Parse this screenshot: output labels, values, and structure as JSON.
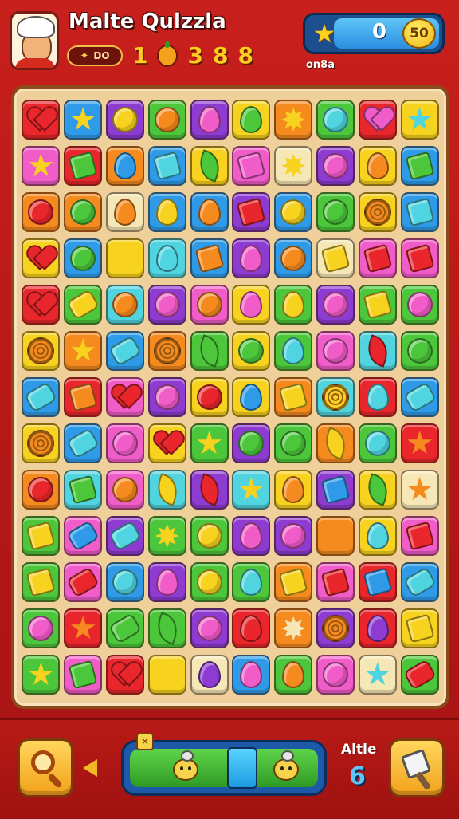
{
  "header": {
    "title": "Malte Qulzzla",
    "level_label": "DO",
    "fruit_count": "1",
    "fruit_stats": [
      "3",
      "8",
      "8"
    ],
    "score": "0",
    "coins": "50",
    "score_caption": "on8a"
  },
  "footer": {
    "moves_label": "Altle",
    "moves_value": "6"
  },
  "colors": {
    "red": "#e8262b",
    "orange": "#f58a1f",
    "yellow": "#f7d21f",
    "green": "#4cc63a",
    "blue": "#2f9be8",
    "purple": "#8d3bd0",
    "pink": "#f05cc8",
    "cream": "#f6e8b6",
    "teal": "#4fd4e0"
  },
  "board": {
    "rows": 13,
    "cols": 10,
    "tiles": [
      [
        [
          "red",
          "heart",
          "red"
        ],
        [
          "blue",
          "star",
          "yellow"
        ],
        [
          "purple",
          "circle",
          "yellow"
        ],
        [
          "green",
          "circle",
          "orange"
        ],
        [
          "purple",
          "drop",
          "pink"
        ],
        [
          "yellow",
          "drop",
          "green"
        ],
        [
          "orange",
          "sun",
          "yellow"
        ],
        [
          "green",
          "circle",
          "teal"
        ],
        [
          "red",
          "heart",
          "pink"
        ],
        [
          "yellow",
          "star",
          "teal"
        ]
      ],
      [
        [
          "pink",
          "star",
          "yellow"
        ],
        [
          "red",
          "square",
          "green"
        ],
        [
          "orange",
          "drop",
          "blue"
        ],
        [
          "blue",
          "square",
          "teal"
        ],
        [
          "yellow",
          "leaf",
          "green"
        ],
        [
          "pink",
          "square",
          "pink"
        ],
        [
          "cream",
          "sun",
          "yellow"
        ],
        [
          "purple",
          "circle",
          "pink"
        ],
        [
          "yellow",
          "drop",
          "orange"
        ],
        [
          "blue",
          "square",
          "green"
        ]
      ],
      [
        [
          "orange",
          "circle",
          "red"
        ],
        [
          "orange",
          "circle",
          "green"
        ],
        [
          "cream",
          "drop",
          "orange"
        ],
        [
          "blue",
          "drop",
          "yellow"
        ],
        [
          "blue",
          "drop",
          "orange"
        ],
        [
          "purple",
          "square",
          "red"
        ],
        [
          "blue",
          "circle",
          "yellow"
        ],
        [
          "green",
          "circle",
          "green"
        ],
        [
          "yellow",
          "swirl",
          "orange"
        ],
        [
          "blue",
          "square",
          "teal"
        ]
      ],
      [
        [
          "yellow",
          "heart",
          "red"
        ],
        [
          "blue",
          "circle",
          "green"
        ],
        [
          "yellow",
          "star",
          "yellow"
        ],
        [
          "teal",
          "drop",
          "teal"
        ],
        [
          "blue",
          "square",
          "orange"
        ],
        [
          "purple",
          "drop",
          "pink"
        ],
        [
          "blue",
          "circle",
          "orange"
        ],
        [
          "cream",
          "square",
          "yellow"
        ],
        [
          "pink",
          "square",
          "red"
        ],
        [
          "pink",
          "square",
          "red"
        ]
      ],
      [
        [
          "red",
          "heart",
          "red"
        ],
        [
          "green",
          "bone",
          "yellow"
        ],
        [
          "teal",
          "circle",
          "orange"
        ],
        [
          "purple",
          "circle",
          "pink"
        ],
        [
          "pink",
          "circle",
          "orange"
        ],
        [
          "yellow",
          "drop",
          "pink"
        ],
        [
          "green",
          "drop",
          "yellow"
        ],
        [
          "purple",
          "circle",
          "pink"
        ],
        [
          "green",
          "square",
          "yellow"
        ],
        [
          "green",
          "circle",
          "pink"
        ]
      ],
      [
        [
          "yellow",
          "swirl",
          "orange"
        ],
        [
          "orange",
          "star",
          "yellow"
        ],
        [
          "blue",
          "bone",
          "teal"
        ],
        [
          "orange",
          "swirl",
          "orange"
        ],
        [
          "green",
          "leaf",
          "green"
        ],
        [
          "yellow",
          "circle",
          "green"
        ],
        [
          "green",
          "drop",
          "teal"
        ],
        [
          "pink",
          "circle",
          "pink"
        ],
        [
          "teal",
          "leaf",
          "red"
        ],
        [
          "green",
          "circle",
          "green"
        ]
      ],
      [
        [
          "blue",
          "bone",
          "teal"
        ],
        [
          "red",
          "square",
          "orange"
        ],
        [
          "pink",
          "heart",
          "red"
        ],
        [
          "purple",
          "circle",
          "pink"
        ],
        [
          "yellow",
          "circle",
          "red"
        ],
        [
          "yellow",
          "drop",
          "blue"
        ],
        [
          "orange",
          "square",
          "yellow"
        ],
        [
          "teal",
          "swirl",
          "yellow"
        ],
        [
          "red",
          "drop",
          "teal"
        ],
        [
          "blue",
          "bone",
          "teal"
        ]
      ],
      [
        [
          "yellow",
          "swirl",
          "orange"
        ],
        [
          "blue",
          "bone",
          "teal"
        ],
        [
          "pink",
          "circle",
          "pink"
        ],
        [
          "yellow",
          "heart",
          "red"
        ],
        [
          "green",
          "star",
          "yellow"
        ],
        [
          "purple",
          "circle",
          "green"
        ],
        [
          "green",
          "circle",
          "green"
        ],
        [
          "orange",
          "leaf",
          "yellow"
        ],
        [
          "green",
          "circle",
          "teal"
        ],
        [
          "red",
          "star",
          "orange"
        ]
      ],
      [
        [
          "orange",
          "circle",
          "red"
        ],
        [
          "teal",
          "square",
          "green"
        ],
        [
          "pink",
          "circle",
          "orange"
        ],
        [
          "teal",
          "leaf",
          "yellow"
        ],
        [
          "purple",
          "leaf",
          "red"
        ],
        [
          "teal",
          "star",
          "yellow"
        ],
        [
          "yellow",
          "drop",
          "orange"
        ],
        [
          "purple",
          "square",
          "blue"
        ],
        [
          "yellow",
          "leaf",
          "green"
        ],
        [
          "cream",
          "star",
          "orange"
        ]
      ],
      [
        [
          "green",
          "square",
          "yellow"
        ],
        [
          "pink",
          "bone",
          "blue"
        ],
        [
          "purple",
          "bone",
          "teal"
        ],
        [
          "green",
          "sun",
          "yellow"
        ],
        [
          "green",
          "circle",
          "yellow"
        ],
        [
          "purple",
          "drop",
          "pink"
        ],
        [
          "purple",
          "circle",
          "pink"
        ],
        [
          "orange",
          "star",
          "orange"
        ],
        [
          "yellow",
          "drop",
          "teal"
        ],
        [
          "pink",
          "square",
          "red"
        ]
      ],
      [
        [
          "green",
          "square",
          "yellow"
        ],
        [
          "pink",
          "bone",
          "red"
        ],
        [
          "blue",
          "circle",
          "teal"
        ],
        [
          "purple",
          "drop",
          "pink"
        ],
        [
          "green",
          "circle",
          "yellow"
        ],
        [
          "green",
          "drop",
          "teal"
        ],
        [
          "orange",
          "square",
          "yellow"
        ],
        [
          "pink",
          "square",
          "red"
        ],
        [
          "red",
          "square",
          "blue"
        ],
        [
          "blue",
          "bone",
          "teal"
        ]
      ],
      [
        [
          "green",
          "circle",
          "pink"
        ],
        [
          "red",
          "star",
          "orange"
        ],
        [
          "green",
          "bone",
          "green"
        ],
        [
          "green",
          "leaf",
          "green"
        ],
        [
          "purple",
          "circle",
          "pink"
        ],
        [
          "red",
          "drop",
          "red"
        ],
        [
          "orange",
          "sun",
          "cream"
        ],
        [
          "purple",
          "swirl",
          "orange"
        ],
        [
          "red",
          "drop",
          "purple"
        ],
        [
          "yellow",
          "square",
          "yellow"
        ]
      ],
      [
        [
          "green",
          "star",
          "yellow"
        ],
        [
          "pink",
          "square",
          "green"
        ],
        [
          "red",
          "heart",
          "red"
        ],
        [
          "yellow",
          "sun",
          "yellow"
        ],
        [
          "cream",
          "drop",
          "purple"
        ],
        [
          "blue",
          "drop",
          "pink"
        ],
        [
          "green",
          "drop",
          "orange"
        ],
        [
          "pink",
          "circle",
          "pink"
        ],
        [
          "cream",
          "star",
          "teal"
        ],
        [
          "green",
          "bone",
          "red"
        ]
      ]
    ]
  }
}
